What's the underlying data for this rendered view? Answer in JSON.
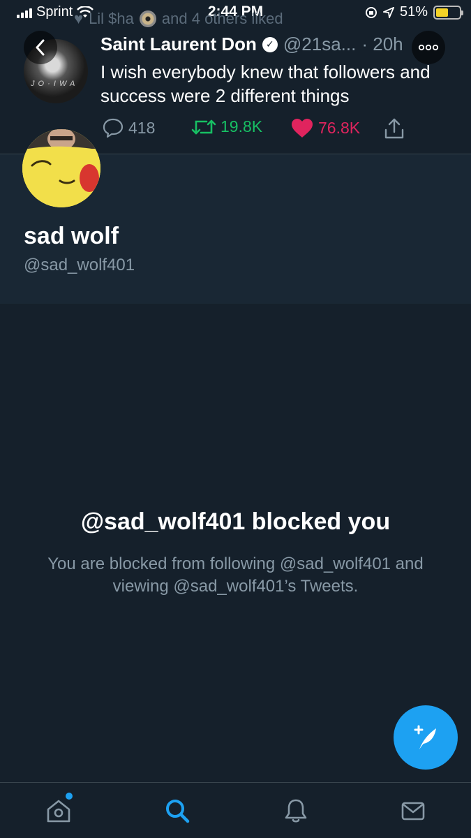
{
  "status_bar": {
    "carrier": "Sprint",
    "time": "2:44 PM",
    "battery": "51%"
  },
  "tweet": {
    "social_context": {
      "liked_by": "Lil $ha",
      "others": "and 4 others liked"
    },
    "author_name": "Saint Laurent Don",
    "author_handle": "@21sa...",
    "time": "· 20h",
    "avatar_caption": "J O · I W A",
    "text": "I wish everybody knew that followers and success were 2 different things",
    "replies": "418",
    "retweets": "19.8K",
    "likes": "76.8K"
  },
  "profile": {
    "name": "sad wolf",
    "handle": "@sad_wolf401"
  },
  "blocked": {
    "title": "@sad_wolf401 blocked you",
    "description": "You are blocked from following @sad_wolf401 and viewing @sad_wolf401’s Tweets."
  },
  "colors": {
    "background": "#15202b",
    "profile_bg": "#192734",
    "accent": "#1da1f2",
    "retweet": "#17bf63",
    "like": "#e0245e",
    "secondary_text": "#8899a6"
  },
  "icons": {
    "back": "chevron-left-icon",
    "more": "more-dots-icon",
    "reply": "reply-bubble-icon",
    "retweet": "retweet-icon",
    "like": "heart-icon",
    "share": "share-icon",
    "compose": "compose-quill-icon",
    "home": "home-icon",
    "search": "search-icon",
    "notifications": "bell-icon",
    "messages": "envelope-icon"
  }
}
